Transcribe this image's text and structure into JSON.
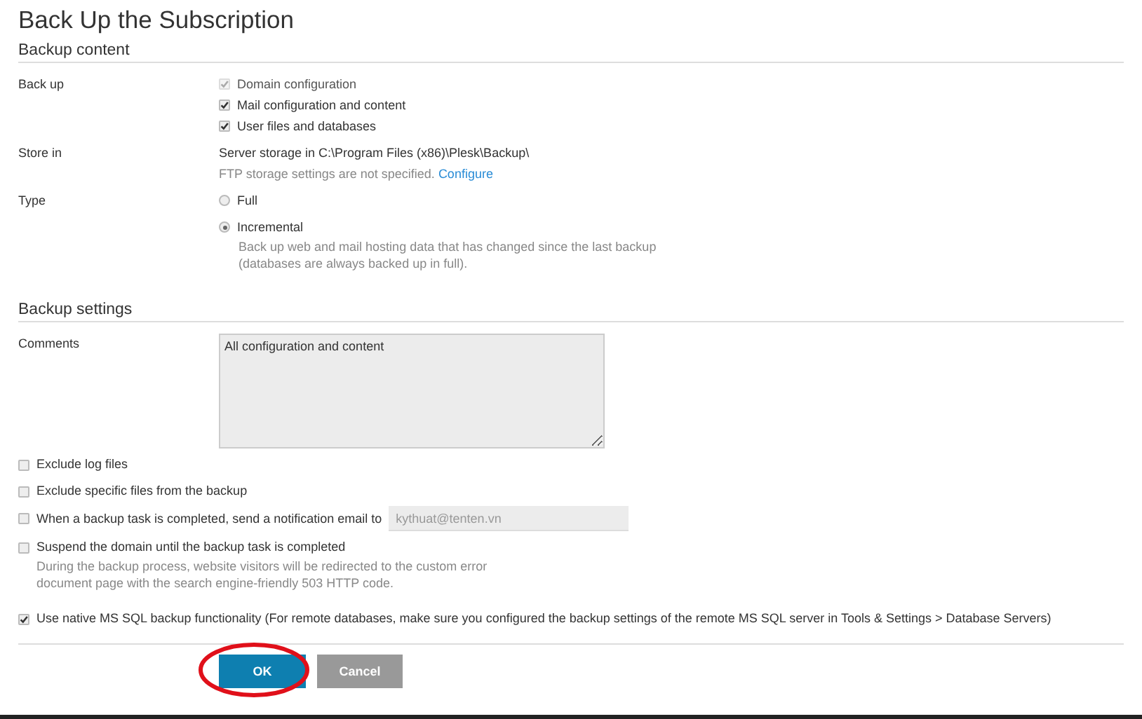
{
  "title": "Back Up the Subscription",
  "backup_content": {
    "heading": "Backup content",
    "back_up": {
      "label": "Back up",
      "options": [
        {
          "label": "Domain configuration",
          "checked": true,
          "disabled": true
        },
        {
          "label": "Mail configuration and content",
          "checked": true,
          "disabled": false
        },
        {
          "label": "User files and databases",
          "checked": true,
          "disabled": false
        }
      ]
    },
    "store_in": {
      "label": "Store in",
      "location": "Server storage in C:\\Program Files (x86)\\Plesk\\Backup\\",
      "ftp_note": "FTP storage settings are not specified.",
      "configure_link": "Configure"
    },
    "type": {
      "label": "Type",
      "options": [
        {
          "label": "Full",
          "selected": false
        },
        {
          "label": "Incremental",
          "selected": true,
          "description": "Back up web and mail hosting data that has changed since the last backup (databases are always backed up in full)."
        }
      ]
    }
  },
  "backup_settings": {
    "heading": "Backup settings",
    "comments": {
      "label": "Comments",
      "value": "All configuration and content"
    },
    "options": [
      {
        "kind": "checkbox",
        "label": "Exclude log files",
        "checked": false
      },
      {
        "kind": "checkbox",
        "label": "Exclude specific files from the backup",
        "checked": false
      },
      {
        "kind": "email",
        "label": "When a backup task is completed, send a notification email to",
        "checked": false,
        "email": "kythuat@tenten.vn"
      },
      {
        "kind": "checkbox",
        "label": "Suspend the domain until the backup task is completed",
        "checked": false,
        "description": "During the backup process, website visitors will be redirected to the custom error document page with the search engine-friendly 503 HTTP code."
      },
      {
        "kind": "checkbox",
        "label": "Use native MS SQL backup functionality (For remote databases, make sure you configured the backup settings of the remote MS SQL server in Tools & Settings > Database Servers)",
        "checked": true
      }
    ]
  },
  "buttons": [
    {
      "label": "OK",
      "kind": "primary",
      "circled": true
    },
    {
      "label": "Cancel",
      "kind": "secondary",
      "circled": false
    }
  ]
}
